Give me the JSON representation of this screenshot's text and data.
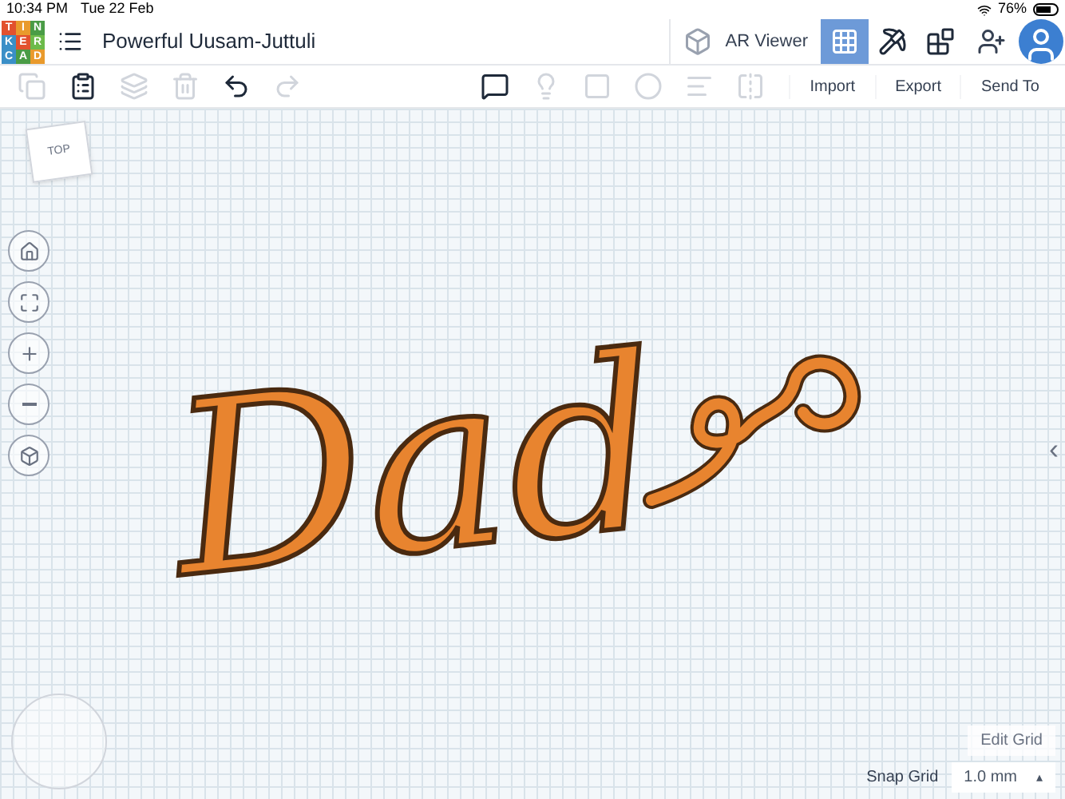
{
  "status_bar": {
    "time": "10:34 PM",
    "date": "Tue 22 Feb",
    "battery": "76%"
  },
  "logo": {
    "letters": [
      {
        "text": "T",
        "color": "#e2512e"
      },
      {
        "text": "I",
        "color": "#e99a2c"
      },
      {
        "text": "N",
        "color": "#4a9c46"
      },
      {
        "text": "K",
        "color": "#3a8fc7"
      },
      {
        "text": "E",
        "color": "#e2512e"
      },
      {
        "text": "R",
        "color": "#6dba4a"
      },
      {
        "text": "C",
        "color": "#3a8fc7"
      },
      {
        "text": "A",
        "color": "#4a9c46"
      },
      {
        "text": "D",
        "color": "#e99a2c"
      }
    ]
  },
  "header": {
    "title": "Powerful Uusam-Juttuli",
    "ar_viewer": "AR Viewer",
    "views": [
      {
        "kind": "grid",
        "selected": true
      },
      {
        "kind": "pickaxe",
        "selected": false
      },
      {
        "kind": "brick",
        "selected": false
      }
    ]
  },
  "toolbar": {
    "tools": [
      {
        "kind": "copy",
        "disabled": true
      },
      {
        "kind": "paste",
        "disabled": false
      },
      {
        "kind": "duplicate",
        "disabled": true
      },
      {
        "kind": "delete",
        "disabled": true
      },
      {
        "kind": "undo",
        "disabled": false
      },
      {
        "kind": "redo",
        "disabled": true
      }
    ],
    "shape_tools": [
      {
        "kind": "notes",
        "disabled": false
      },
      {
        "kind": "light",
        "disabled": true
      },
      {
        "kind": "group",
        "disabled": true
      },
      {
        "kind": "hole",
        "disabled": true
      },
      {
        "kind": "align",
        "disabled": true
      },
      {
        "kind": "mirror",
        "disabled": true
      }
    ],
    "actions": [
      "Import",
      "Export",
      "Send To"
    ]
  },
  "view_cube": {
    "label": "TOP"
  },
  "nav_buttons": [
    {
      "kind": "home"
    },
    {
      "kind": "fit"
    },
    {
      "kind": "zoom_in"
    },
    {
      "kind": "zoom_out"
    },
    {
      "kind": "perspective"
    }
  ],
  "model": {
    "text": "Dad"
  },
  "grid_controls": {
    "edit_grid": "Edit Grid",
    "snap_label": "Snap Grid",
    "snap_value": "1.0 mm",
    "caret": "▴"
  },
  "side_toggle": "‹"
}
